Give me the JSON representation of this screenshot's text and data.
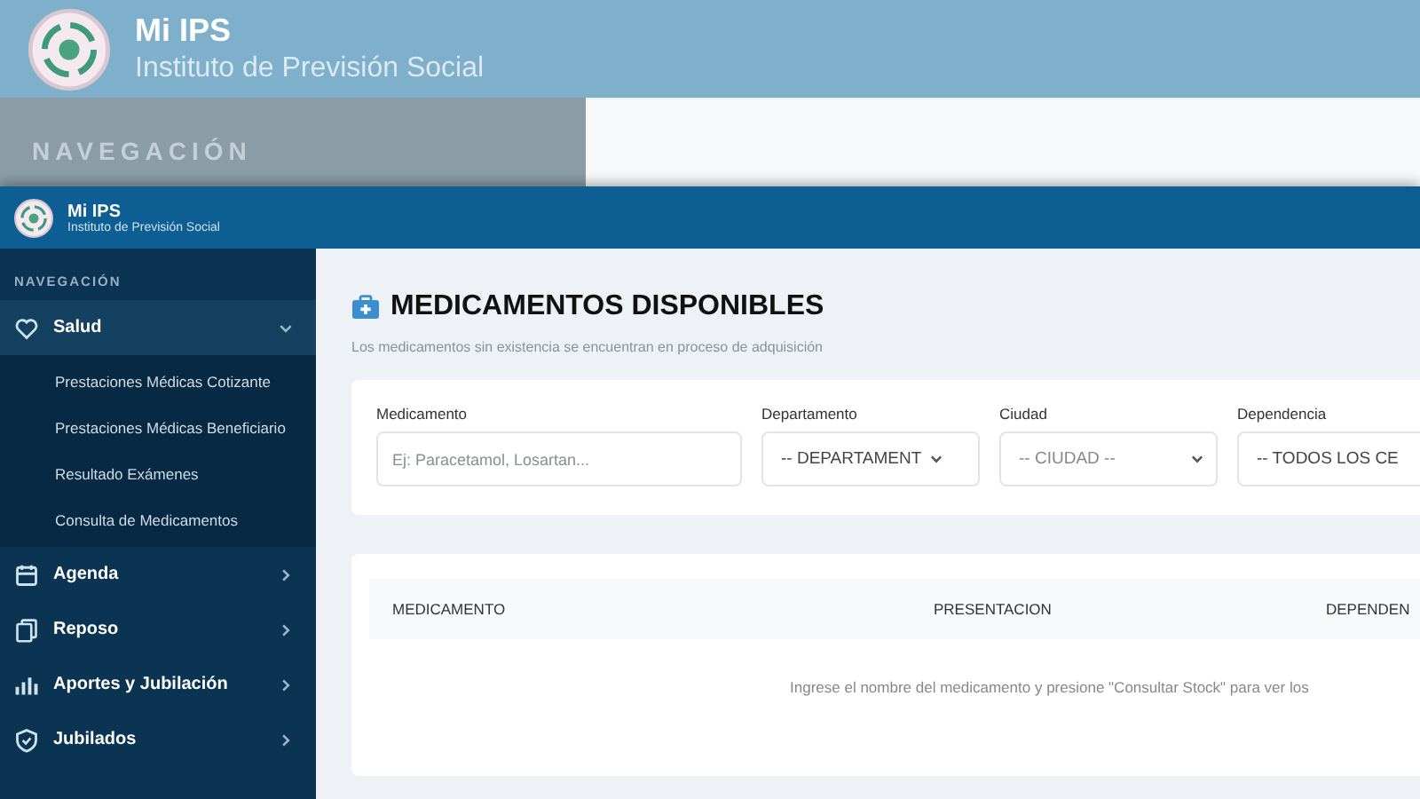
{
  "backdrop": {
    "app_name": "Mi IPS",
    "org_name": "Instituto de Previsión Social",
    "nav_heading": "NAVEGACIÓN"
  },
  "header": {
    "app_name": "Mi IPS",
    "org_name": "Instituto de Previsión Social"
  },
  "sidebar": {
    "heading": "NAVEGACIÓN",
    "items": [
      {
        "label": "Salud",
        "selected": true,
        "expanded": true,
        "children": [
          {
            "label": "Prestaciones Médicas Cotizante"
          },
          {
            "label": "Prestaciones Médicas Beneficiario"
          },
          {
            "label": "Resultado Exámenes"
          },
          {
            "label": "Consulta de Medicamentos"
          }
        ]
      },
      {
        "label": "Agenda",
        "selected": false,
        "expanded": false
      },
      {
        "label": "Reposo",
        "selected": false,
        "expanded": false
      },
      {
        "label": "Aportes y Jubilación",
        "selected": false,
        "expanded": false
      },
      {
        "label": "Jubilados",
        "selected": false,
        "expanded": false
      }
    ]
  },
  "page": {
    "title": "MEDICAMENTOS DISPONIBLES",
    "subtitle": "Los medicamentos sin existencia se encuentran en proceso de adquisición"
  },
  "filters": [
    {
      "kind": "text",
      "label": "Medicamento",
      "placeholder": "Ej: Paracetamol, Losartan..."
    },
    {
      "kind": "select",
      "label": "Departamento",
      "value": "-- DEPARTAMENT"
    },
    {
      "kind": "select",
      "label": "Ciudad",
      "value": "-- CIUDAD --"
    },
    {
      "kind": "select",
      "label": "Dependencia",
      "value": "-- TODOS LOS CE"
    }
  ],
  "table": {
    "columns": [
      "MEDICAMENTO",
      "PRESENTACION",
      "DEPENDEN"
    ],
    "empty_message": "Ingrese el nombre del medicamento y presione \"Consultar Stock\" para ver los"
  }
}
